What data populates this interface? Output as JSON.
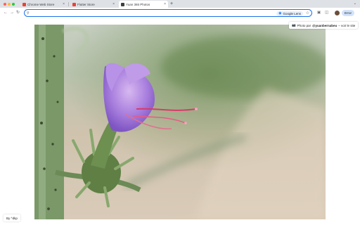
{
  "window": {
    "tabs": [
      {
        "label": "Chrome Web Store",
        "favicon_color": "#ea4335",
        "active": false
      },
      {
        "label": "Flutter Store",
        "favicon_color": "#ea4335",
        "active": false
      },
      {
        "label": "Yuan 365 Photos",
        "favicon_color": "#3c4043",
        "active": true
      }
    ],
    "new_tab_symbol": "+",
    "tab_menu_symbol": "⌄"
  },
  "toolbar": {
    "back_symbol": "←",
    "forward_symbol": "→",
    "reload_symbol": "↻",
    "address_value": "",
    "lens_label": "Google Lens",
    "profile_label": "Error"
  },
  "photo": {
    "credit_prefix": "Photo par",
    "credit_author": "@yuanbernabeu",
    "credit_suffix": "– voir le site",
    "by_label": "By ^dkp"
  },
  "colors": {
    "accent": "#1a73e8",
    "tabbar": "#dee1e6",
    "flower": "#9b6fd6"
  }
}
